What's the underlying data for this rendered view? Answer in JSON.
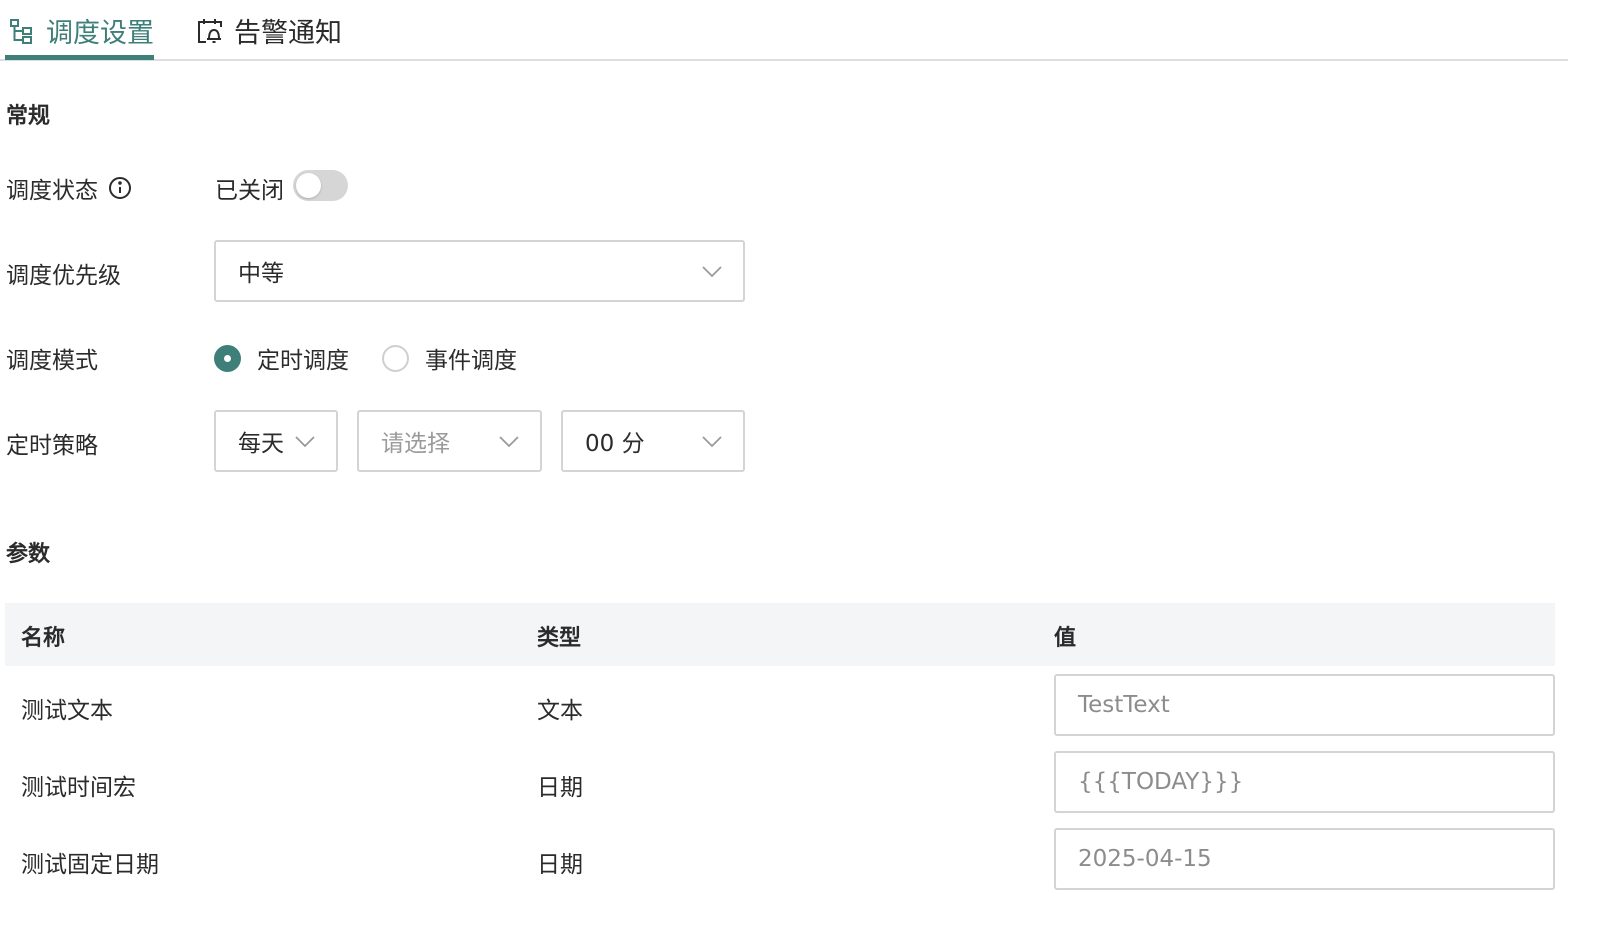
{
  "tabs": [
    {
      "label": "调度设置",
      "active": true,
      "icon": "tree-icon"
    },
    {
      "label": "告警通知",
      "active": false,
      "icon": "calendar-alarm-icon"
    }
  ],
  "general": {
    "section_title": "常规",
    "status": {
      "label": "调度状态",
      "value_text": "已关闭",
      "enabled": false
    },
    "priority": {
      "label": "调度优先级",
      "value": "中等"
    },
    "mode": {
      "label": "调度模式",
      "options": [
        "定时调度",
        "事件调度"
      ],
      "selected": "定时调度"
    },
    "strategy": {
      "label": "定时策略",
      "frequency": "每天",
      "hour_placeholder": "请选择",
      "minute": "00 分"
    }
  },
  "params": {
    "section_title": "参数",
    "columns": [
      "名称",
      "类型",
      "值"
    ],
    "rows": [
      {
        "name": "测试文本",
        "type": "文本",
        "value": "TestText"
      },
      {
        "name": "测试时间宏",
        "type": "日期",
        "value": "{{{TODAY}}}"
      },
      {
        "name": "测试固定日期",
        "type": "日期",
        "value": "2025-04-15"
      }
    ]
  },
  "colors": {
    "accent": "#3e7f79",
    "border": "#d4d4d4",
    "header_bg": "#f4f5f7"
  }
}
